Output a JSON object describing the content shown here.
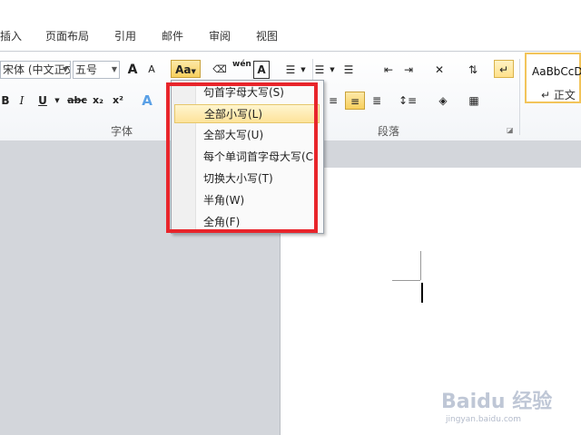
{
  "tabs": [
    "插入",
    "页面布局",
    "引用",
    "邮件",
    "审阅",
    "视图"
  ],
  "ribbon": {
    "font_name": "宋体 (中文正文)",
    "font_size": "五号",
    "grow_font": "A",
    "shrink_font": "A",
    "change_case": "Aa",
    "phonetic": "wén",
    "char_border": "A",
    "bold": "B",
    "italic": "I",
    "underline": "U",
    "strikethrough": "abc",
    "subscript": "x₂",
    "superscript": "x²",
    "text_effect": "A",
    "font_group": "字体",
    "paragraph_group": "段落"
  },
  "styles": {
    "sample": "AaBbCcDc",
    "name": "↵ 正文"
  },
  "menu": {
    "items": [
      {
        "label": "句首字母大写(S)"
      },
      {
        "label": "全部小写(L)"
      },
      {
        "label": "全部大写(U)"
      },
      {
        "label": "每个单词首字母大写(C)"
      },
      {
        "label": "切换大小写(T)"
      },
      {
        "label": "半角(W)"
      },
      {
        "label": "全角(F)"
      }
    ]
  },
  "watermark": {
    "main": "Baidu 经验",
    "sub": "jingyan.baidu.com"
  }
}
